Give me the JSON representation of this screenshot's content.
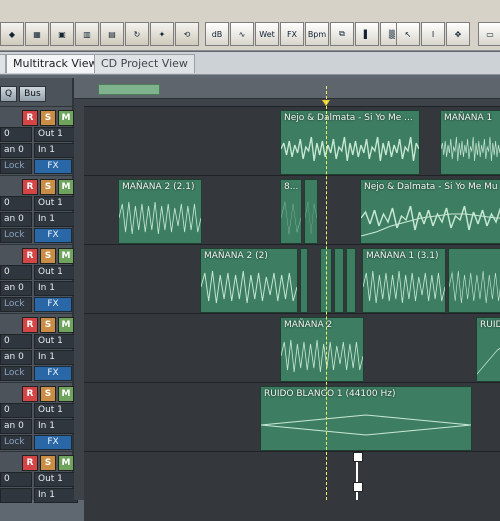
{
  "tabs": [
    {
      "label": "Multitrack View",
      "active": true
    },
    {
      "label": "CD Project View",
      "active": false
    }
  ],
  "left_panel": {
    "header_buttons": [
      "Q",
      "Bus"
    ],
    "track_controls": [
      {
        "vol": "0",
        "out": "Out 1",
        "pan": "an 0",
        "in": "In 1",
        "lock": "Lock",
        "fx": "FX"
      },
      {
        "vol": "0",
        "out": "Out 1",
        "pan": "an 0",
        "in": "In 1",
        "lock": "Lock",
        "fx": "FX"
      },
      {
        "vol": "0",
        "out": "Out 1",
        "pan": "an 0",
        "in": "In 1",
        "lock": "Lock",
        "fx": "FX"
      },
      {
        "vol": "0",
        "out": "Out 1",
        "pan": "an 0",
        "in": "In 1",
        "lock": "Lock",
        "fx": "FX"
      },
      {
        "vol": "0",
        "out": "Out 1",
        "pan": "an 0",
        "in": "In 1",
        "lock": "Lock",
        "fx": "FX"
      },
      {
        "vol": "0",
        "out": "Out 1",
        "pan": "",
        "in": "In 1",
        "lock": "",
        "fx": ""
      }
    ]
  },
  "toolbar": {
    "labels": [
      "dB",
      "Wet",
      "FX",
      "Bpm"
    ]
  },
  "clips": {
    "track1": [
      {
        "label": "Nejo & Dalmata - Si Yo Me ..."
      },
      {
        "label": "MAÑANA 1"
      }
    ],
    "track2": [
      {
        "label": "MAÑANA 2 (2.1)"
      },
      {
        "label": "8..."
      },
      {
        "label": "Nejo & Dalmata - Si Yo Me Mu"
      }
    ],
    "track3": [
      {
        "label": "MAÑANA 2 (2)"
      },
      {
        "label": "MAÑANA 1 (3.1)"
      }
    ],
    "track4": [
      {
        "label": "MAÑANA 2"
      },
      {
        "label": "RUID"
      }
    ],
    "track5": [
      {
        "label": "RUIDO BLANCO 1 (44100 Hz)"
      }
    ]
  },
  "colors": {
    "clip": "#3d7d62",
    "clip_border": "#1f3e30",
    "track_bg": "#34383d",
    "fx_button": "#2a67a6",
    "playhead": "#f0d02a"
  }
}
